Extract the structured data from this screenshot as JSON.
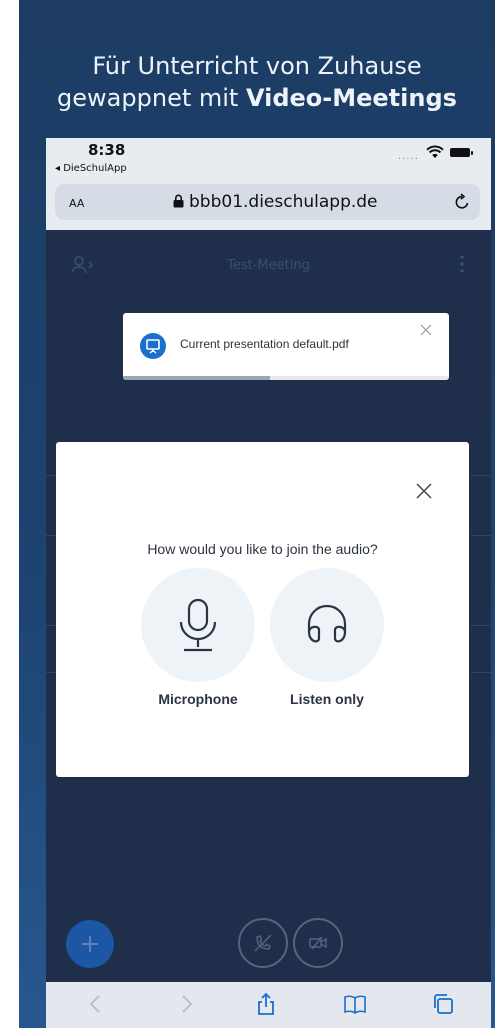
{
  "promo": {
    "line1": "Für Unterricht von Zuhause",
    "line2_prefix": "gewappnet mit ",
    "line2_bold": "Video-Meetings"
  },
  "status_bar": {
    "time": "8:38",
    "back_app": "◂ DieSchulApp",
    "signal": "....."
  },
  "browser": {
    "text_size": "AA",
    "url": "bbb01.dieschulapp.de"
  },
  "meeting": {
    "title": "Test-Meeting"
  },
  "toast": {
    "message": "Current presentation default.pdf",
    "progress": 0.45
  },
  "audio_modal": {
    "question": "How would you like to join the audio?",
    "options": [
      {
        "label": "Microphone",
        "icon": "microphone-icon"
      },
      {
        "label": "Listen only",
        "icon": "headphones-icon"
      }
    ]
  },
  "colors": {
    "background": "#1d4370",
    "accent": "#1a6fce",
    "meeting_bg": "#1f2e4b"
  }
}
